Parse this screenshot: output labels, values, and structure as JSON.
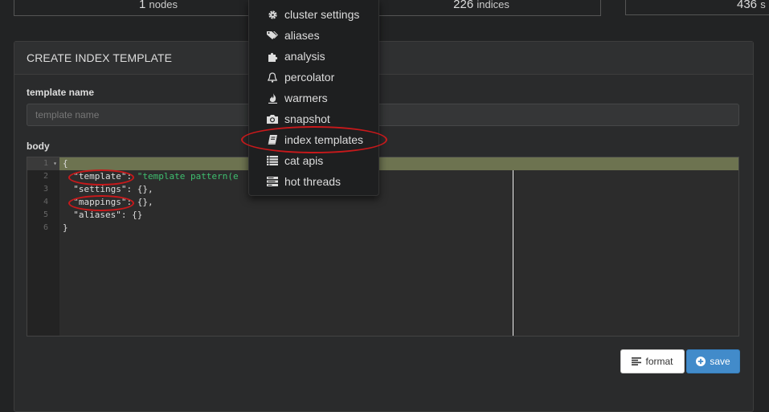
{
  "stats": {
    "nodes": {
      "count": "1",
      "label": "nodes"
    },
    "indices": {
      "count": "226",
      "label": "indices"
    },
    "shards": {
      "count": "436",
      "label": "s"
    }
  },
  "panel": {
    "title": "CREATE INDEX TEMPLATE",
    "name_label": "template name",
    "name_placeholder": "template name",
    "body_label": "body"
  },
  "editor": {
    "line_numbers": [
      "1",
      "2",
      "3",
      "4",
      "5",
      "6"
    ],
    "lines": {
      "l1": "{",
      "l2_key": "\"template\"",
      "l2_rest": ": ",
      "l2_val": "\"template pattern(e",
      "l3": "  \"settings\": {},",
      "l4_key": "\"mappings\"",
      "l4_rest": ": {},",
      "l5": "  \"aliases\": {}",
      "l6": "}"
    }
  },
  "buttons": {
    "format": "format",
    "save": "save"
  },
  "menu": {
    "items": [
      {
        "label": "cluster settings",
        "icon": "gear-icon"
      },
      {
        "label": "aliases",
        "icon": "tags-icon"
      },
      {
        "label": "analysis",
        "icon": "puzzle-icon"
      },
      {
        "label": "percolator",
        "icon": "bell-icon"
      },
      {
        "label": "warmers",
        "icon": "fire-icon"
      },
      {
        "label": "snapshot",
        "icon": "camera-icon"
      },
      {
        "label": "index templates",
        "icon": "book-icon"
      },
      {
        "label": "cat apis",
        "icon": "list-icon"
      },
      {
        "label": "hot threads",
        "icon": "tasks-icon"
      }
    ]
  },
  "colors": {
    "annotation": "#c8191b",
    "save_button": "#428bca",
    "active_line": "#6d7350",
    "string_value": "#3fbf6f"
  }
}
